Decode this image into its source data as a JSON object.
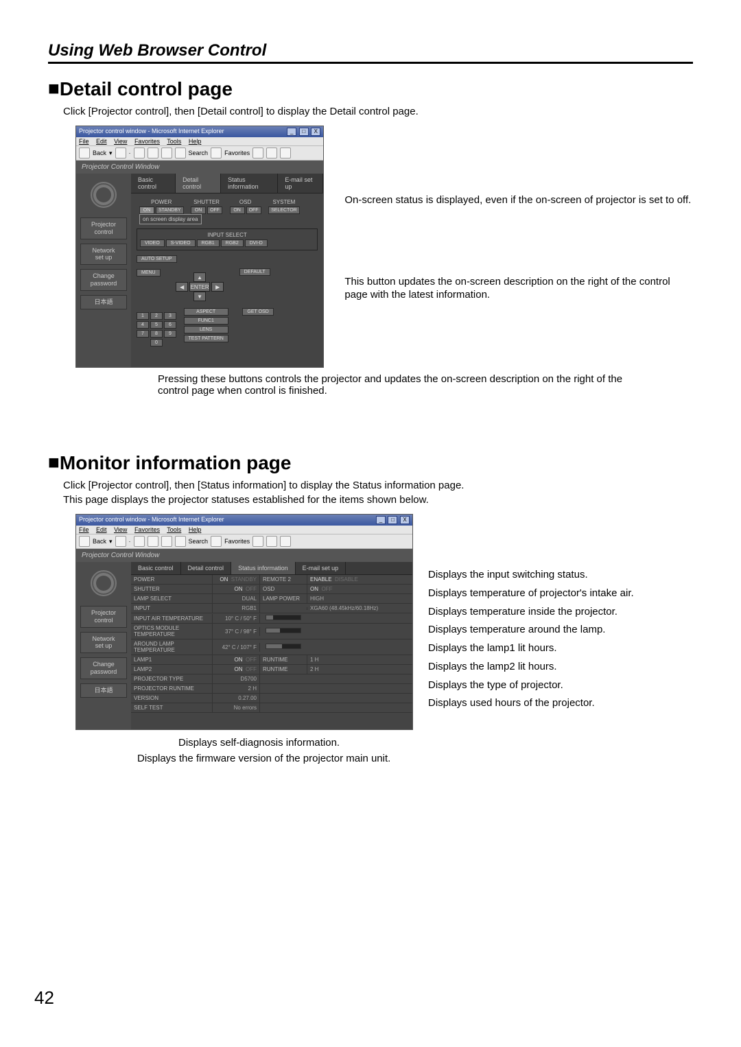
{
  "header": "Using Web Browser Control",
  "section1": {
    "title": "Detail control page",
    "intro": "Click [Projector control], then [Detail control] to display the Detail control page.",
    "bottomCaption": "Pressing these buttons controls the projector and updates the on-screen description on the right of the control page when control is finished."
  },
  "section2": {
    "title": "Monitor information page",
    "intro1": "Click [Projector control], then [Status information] to display the Status information page.",
    "intro2": "This page displays the projector statuses established for the items shown below."
  },
  "window": {
    "title": "Projector control window - Microsoft Internet Explorer",
    "menus": [
      "File",
      "Edit",
      "View",
      "Favorites",
      "Tools",
      "Help"
    ],
    "toolbarBack": "Back",
    "toolbarSearch": "Search",
    "toolbarFav": "Favorites",
    "appbar": "Projector Control Window"
  },
  "sidebar": {
    "items": [
      "Projector\ncontrol",
      "Network\nset up",
      "Change\npassword",
      "日本語"
    ]
  },
  "tabs": [
    "Basic control",
    "Detail control",
    "Status information",
    "E-mail set up"
  ],
  "detail": {
    "powerLabel": "POWER",
    "powerOn": "ON",
    "powerStandby": "STANDBY",
    "shutterLabel": "SHUTTER",
    "on": "ON",
    "off": "OFF",
    "osdLabel": "OSD",
    "systemLabel": "SYSTEM",
    "selector": "SELECTOR",
    "osda": "on screen display area",
    "inputSelect": "INPUT SELECT",
    "inputs": [
      "VIDEO",
      "S-VIDEO",
      "RGB1",
      "RGB2",
      "DVI-D"
    ],
    "autoSetup": "AUTO SETUP",
    "menu": "MENU",
    "enter": "ENTER",
    "default": "DEFAULT",
    "aspect": "ASPECT",
    "func1": "FUNC1",
    "lens": "LENS",
    "testPattern": "TEST PATTERN",
    "getOsd": "GET OSD",
    "nums": [
      "1",
      "2",
      "3",
      "4",
      "5",
      "6",
      "7",
      "8",
      "9",
      "0"
    ]
  },
  "callouts1": {
    "a": "On-screen status is displayed, even if the on-screen of projector is set to off.",
    "b": "This button updates the on-screen description on the right of the control page with the latest information."
  },
  "status": {
    "rows": [
      {
        "l1": "POWER",
        "v1on": "ON",
        "v1off": "STANDBY",
        "l2": "REMOTE 2",
        "v2a": "ENABLE",
        "v2b": "DISABLE"
      },
      {
        "l1": "SHUTTER",
        "v1on": "ON",
        "v1off": "OFF",
        "l2": "OSD",
        "v2a": "ON",
        "v2b": "OFF"
      },
      {
        "l1": "LAMP SELECT",
        "v1": "DUAL",
        "l2": "LAMP POWER",
        "v2": "HIGH"
      },
      {
        "l1": "INPUT",
        "v1": "RGB1",
        "l2": "",
        "v2": "XGA60 (48.45kHz/60.18Hz)"
      },
      {
        "l1": "INPUT AIR TEMPERATURE",
        "v1": "10° C / 50° F",
        "bar": 20
      },
      {
        "l1": "OPTICS MODULE TEMPERATURE",
        "v1": "37° C / 98° F",
        "bar": 40
      },
      {
        "l1": "AROUND LAMP TEMPERATURE",
        "v1": "42° C / 107° F",
        "bar": 45
      },
      {
        "l1": "LAMP1",
        "v1a": "ON",
        "v1b": "OFF",
        "l2": "RUNTIME",
        "v2": "1 H"
      },
      {
        "l1": "LAMP2",
        "v1a": "ON",
        "v1b": "OFF",
        "l2": "RUNTIME",
        "v2": "2 H"
      },
      {
        "l1": "PROJECTOR TYPE",
        "v1": "D5700"
      },
      {
        "l1": "PROJECTOR RUNTIME",
        "v1": "2 H"
      },
      {
        "l1": "VERSION",
        "v1": "0.27.00"
      },
      {
        "l1": "SELF TEST",
        "v1": "No errors"
      }
    ]
  },
  "callouts2": [
    "Displays the input switching status.",
    "Displays temperature of projector's intake air.",
    "Displays temperature inside the projector.",
    "Displays temperature around the lamp.",
    "Displays the lamp1 lit hours.",
    "Displays the lamp2 lit hours.",
    "Displays the type of projector.",
    "Displays used hours of the projector."
  ],
  "belowCaptions": [
    "Displays self-diagnosis information.",
    "Displays the firmware version of the projector main unit."
  ],
  "pageNumber": "42"
}
